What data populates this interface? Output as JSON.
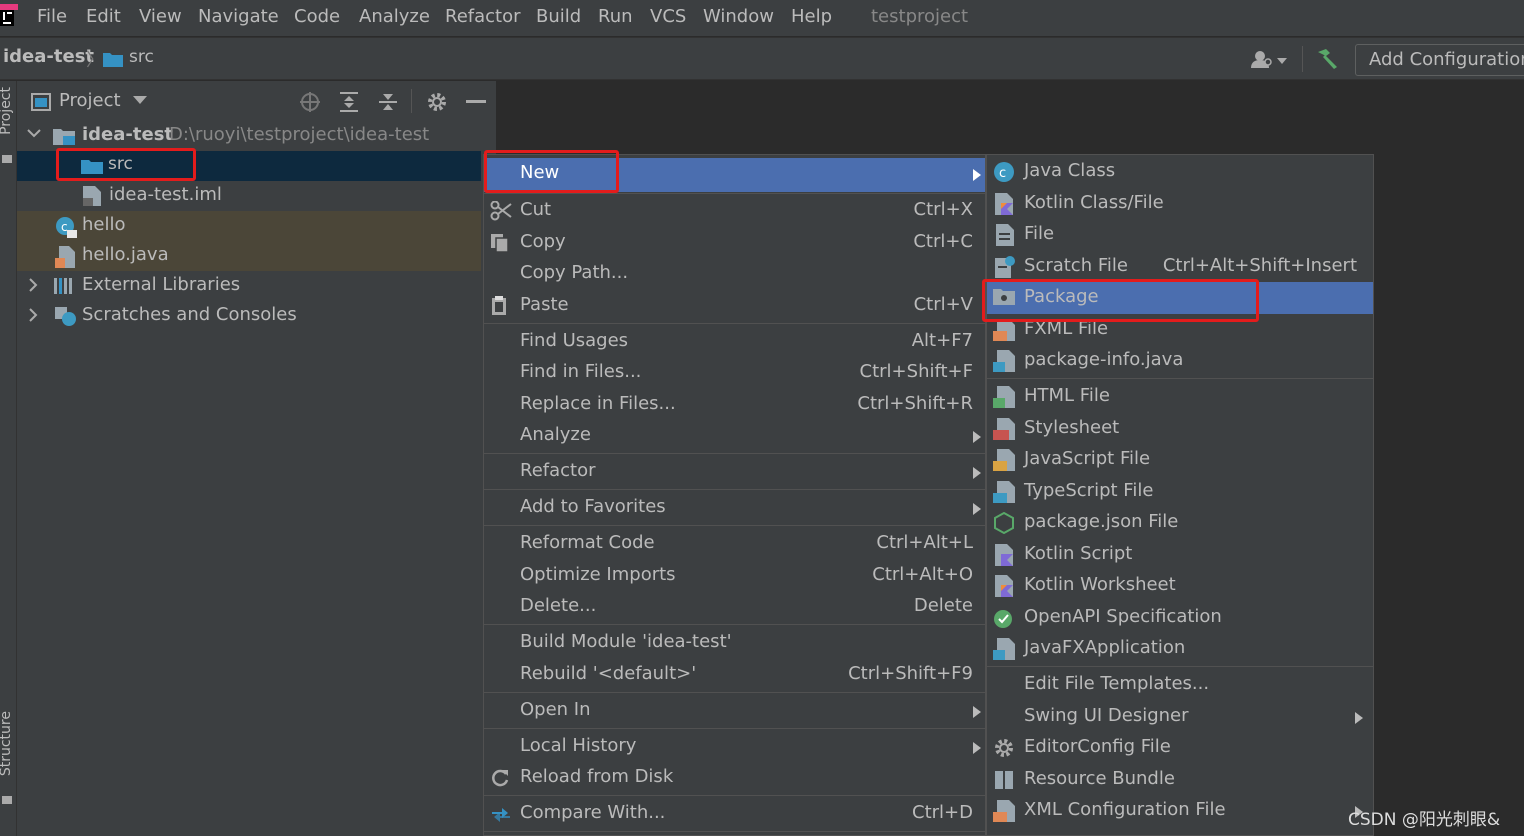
{
  "menubar": {
    "items": [
      "File",
      "Edit",
      "View",
      "Navigate",
      "Code",
      "Analyze",
      "Refactor",
      "Build",
      "Run",
      "VCS",
      "Window",
      "Help"
    ],
    "title": "testproject"
  },
  "navbar": {
    "project": "idea-test",
    "folder": "src",
    "run_config": "Add Configuration..."
  },
  "tool_strip": {
    "top_tab": "Project",
    "bottom_tab": "Structure"
  },
  "project_panel": {
    "title": "Project",
    "tree": [
      {
        "label": "idea-test",
        "path": "D:\\ruoyi\\testproject\\idea-test"
      },
      {
        "label": "src"
      },
      {
        "label": "idea-test.iml"
      },
      {
        "label": "hello"
      },
      {
        "label": "hello.java"
      },
      {
        "label": "External Libraries"
      },
      {
        "label": "Scratches and Consoles"
      }
    ]
  },
  "context_menu": {
    "items": [
      {
        "label": "New"
      },
      {
        "label": "Cut",
        "shortcut": "Ctrl+X"
      },
      {
        "label": "Copy",
        "shortcut": "Ctrl+C"
      },
      {
        "label": "Copy Path..."
      },
      {
        "label": "Paste",
        "shortcut": "Ctrl+V"
      },
      {
        "label": "Find Usages",
        "shortcut": "Alt+F7"
      },
      {
        "label": "Find in Files...",
        "shortcut": "Ctrl+Shift+F"
      },
      {
        "label": "Replace in Files...",
        "shortcut": "Ctrl+Shift+R"
      },
      {
        "label": "Analyze"
      },
      {
        "label": "Refactor"
      },
      {
        "label": "Add to Favorites"
      },
      {
        "label": "Reformat Code",
        "shortcut": "Ctrl+Alt+L"
      },
      {
        "label": "Optimize Imports",
        "shortcut": "Ctrl+Alt+O"
      },
      {
        "label": "Delete...",
        "shortcut": "Delete"
      },
      {
        "label": "Build Module 'idea-test'"
      },
      {
        "label": "Rebuild '<default>'",
        "shortcut": "Ctrl+Shift+F9"
      },
      {
        "label": "Open In"
      },
      {
        "label": "Local History"
      },
      {
        "label": "Reload from Disk"
      },
      {
        "label": "Compare With...",
        "shortcut": "Ctrl+D"
      }
    ]
  },
  "new_submenu": {
    "items": [
      {
        "label": "Java Class"
      },
      {
        "label": "Kotlin Class/File"
      },
      {
        "label": "File"
      },
      {
        "label": "Scratch File",
        "shortcut": "Ctrl+Alt+Shift+Insert"
      },
      {
        "label": "Package"
      },
      {
        "label": "FXML File"
      },
      {
        "label": "package-info.java"
      },
      {
        "label": "HTML File"
      },
      {
        "label": "Stylesheet"
      },
      {
        "label": "JavaScript File"
      },
      {
        "label": "TypeScript File"
      },
      {
        "label": "package.json File"
      },
      {
        "label": "Kotlin Script"
      },
      {
        "label": "Kotlin Worksheet"
      },
      {
        "label": "OpenAPI Specification"
      },
      {
        "label": "JavaFXApplication"
      },
      {
        "label": "Edit File Templates..."
      },
      {
        "label": "Swing UI Designer"
      },
      {
        "label": "EditorConfig File"
      },
      {
        "label": "Resource Bundle"
      },
      {
        "label": "XML Configuration File"
      }
    ]
  },
  "watermark": "CSDN @阳光刺眼&",
  "colors": {
    "menu_bg": "#3c3f41",
    "editor_bg": "#2b2b2b",
    "highlight": "#4b6eaf",
    "selection_row": "#0d293e",
    "annotation_red": "#e31c1c"
  }
}
